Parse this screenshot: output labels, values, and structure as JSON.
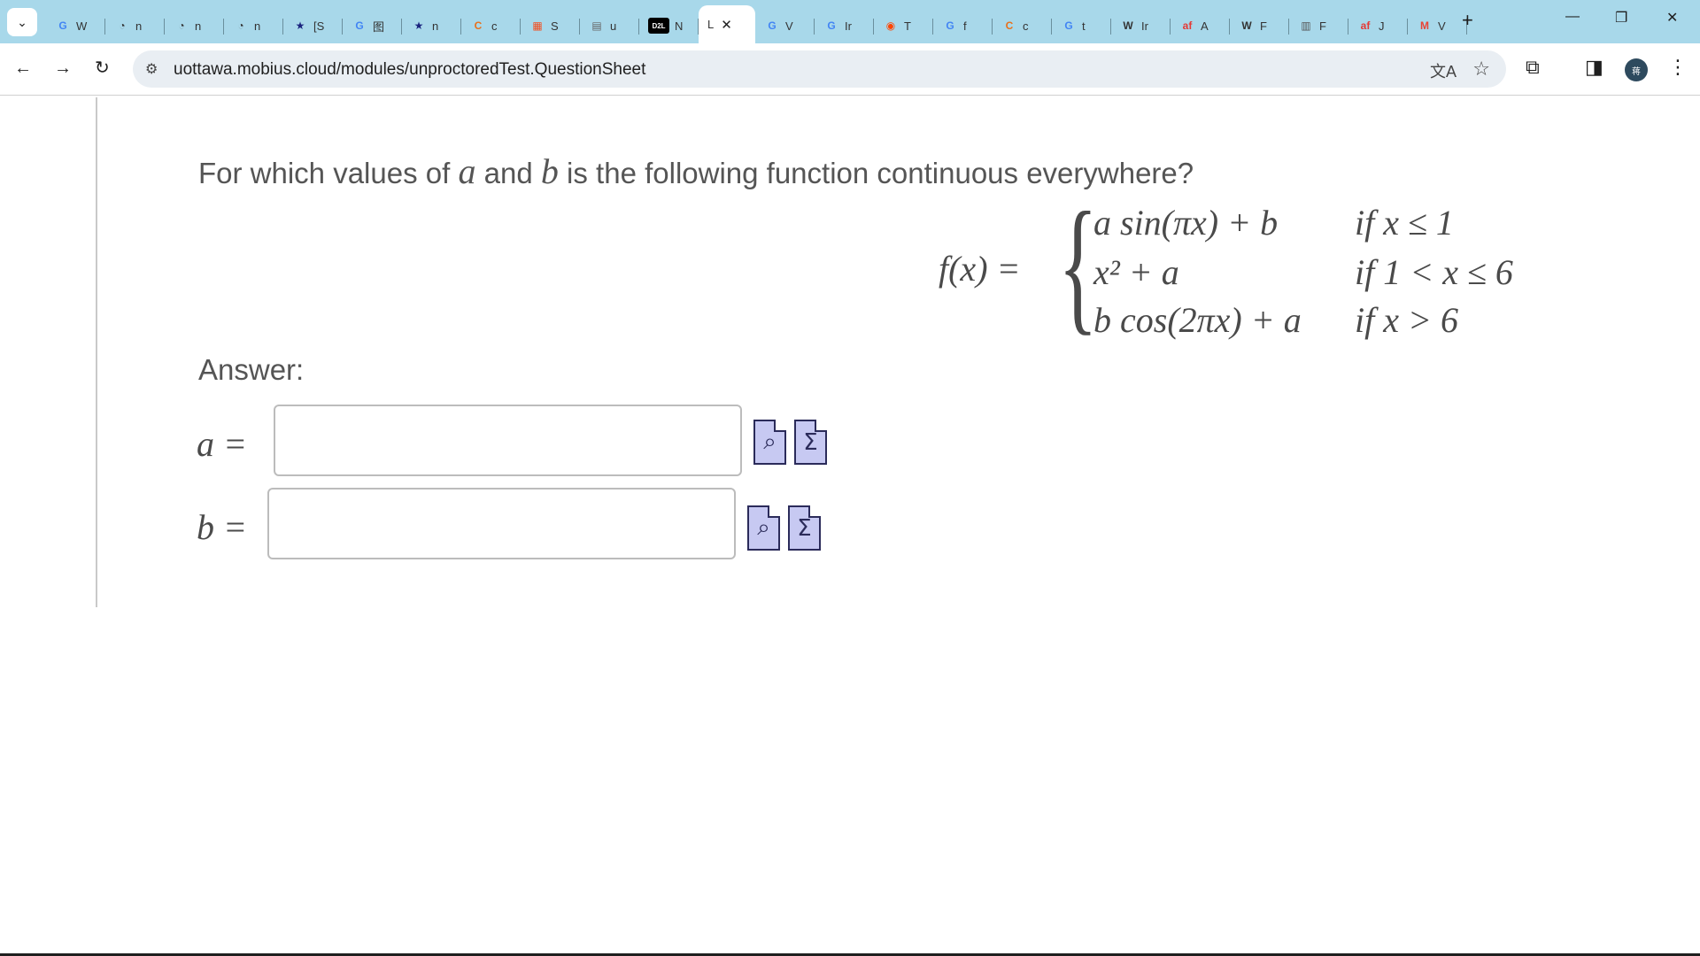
{
  "browser": {
    "tabs": [
      {
        "letter": "G",
        "label": "W",
        "color": "#4285F4"
      },
      {
        "letter": "◔",
        "label": "n",
        "color": "#333333"
      },
      {
        "letter": "◔",
        "label": "n",
        "color": "#333333"
      },
      {
        "letter": "◔",
        "label": "n",
        "color": "#333333"
      },
      {
        "letter": "★",
        "label": "[S",
        "color": "#1a237e"
      },
      {
        "letter": "G",
        "label": "图",
        "color": "#4285F4"
      },
      {
        "letter": "★",
        "label": "n",
        "color": "#1a237e"
      },
      {
        "letter": "C",
        "label": "c",
        "color": "#e8711c"
      },
      {
        "letter": "▦",
        "label": "S",
        "color": "#f25022"
      },
      {
        "letter": "▤",
        "label": "u",
        "color": "#666666"
      },
      {
        "letter": "D2L",
        "label": "N",
        "color": "#000000"
      },
      {
        "letter": "",
        "label": "L",
        "color": "#333333",
        "active": true
      },
      {
        "letter": "G",
        "label": "V",
        "color": "#4285F4"
      },
      {
        "letter": "G",
        "label": "Ir",
        "color": "#4285F4"
      },
      {
        "letter": "◉",
        "label": "T",
        "color": "#ff4500"
      },
      {
        "letter": "G",
        "label": "f",
        "color": "#4285F4"
      },
      {
        "letter": "C",
        "label": "c",
        "color": "#e8711c"
      },
      {
        "letter": "G",
        "label": "t",
        "color": "#4285F4"
      },
      {
        "letter": "W",
        "label": "Ir",
        "color": "#333333"
      },
      {
        "letter": "af",
        "label": "A",
        "color": "#e53935"
      },
      {
        "letter": "W",
        "label": "F",
        "color": "#333333"
      },
      {
        "letter": "▥",
        "label": "F",
        "color": "#555555"
      },
      {
        "letter": "af",
        "label": "J",
        "color": "#e53935"
      },
      {
        "letter": "M",
        "label": "V",
        "color": "#ea4335"
      }
    ],
    "active_tab_close": "✕",
    "new_tab": "+",
    "url": "uottawa.mobius.cloud/modules/unproctoredTest.QuestionSheet",
    "profile_initials": "蒋"
  },
  "question": {
    "prefix": "For which values of ",
    "var_a": "a",
    "middle": " and ",
    "var_b": "b",
    "suffix": " is the following function continuous everywhere?"
  },
  "function_def": {
    "lhs": "f(x) =",
    "pieces": [
      {
        "expr": "a sin(πx) + b",
        "condition": "if x ≤ 1"
      },
      {
        "expr": "x² + a",
        "condition": "if 1 < x ≤ 6"
      },
      {
        "expr": "b cos(2πx) + a",
        "condition": "if x > 6"
      }
    ]
  },
  "answer": {
    "label": "Answer:",
    "a_label": "a =",
    "b_label": "b =",
    "a_value": "",
    "b_value": ""
  },
  "tool_icons": {
    "preview_symbol": "⌕",
    "equation_symbol": "Σ"
  }
}
